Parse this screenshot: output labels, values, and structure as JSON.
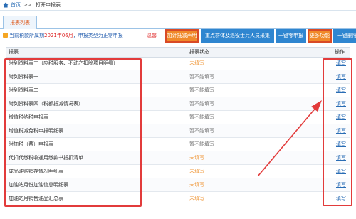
{
  "breadcrumb": {
    "home_label": "首页",
    "separator": ">>",
    "current": "打开申报表"
  },
  "tab": {
    "label": "报表列表"
  },
  "notice": {
    "prefix": "当前税款所属期",
    "period": "2021年06月",
    "middle": "，申报类型为",
    "type": "正常申报",
    "tip": "温馨"
  },
  "toolbar": {
    "buttons": [
      {
        "label": "加计抵减声明",
        "style": "orange"
      },
      {
        "label": "重点群体及退役士兵人员采集",
        "style": "blue"
      },
      {
        "label": "一键零申报",
        "style": "blue"
      },
      {
        "label": "更多功能",
        "style": "orange"
      },
      {
        "label": "一键删除",
        "style": "blue"
      }
    ]
  },
  "table": {
    "headers": [
      "报表",
      "报表状态",
      "操作"
    ],
    "rows": [
      {
        "name": "附列资料表三（应税服务、不动产扣除项目明细）",
        "status": "未填写",
        "status_kind": "todo",
        "action": "填写"
      },
      {
        "name": "附列资料表一",
        "status": "暂不能填写",
        "status_kind": "na",
        "action": "填写"
      },
      {
        "name": "附列资料表二",
        "status": "暂不能填写",
        "status_kind": "na",
        "action": "填写"
      },
      {
        "name": "附列资料表四（税额抵减情况表）",
        "status": "暂不能填写",
        "status_kind": "na",
        "action": "填写"
      },
      {
        "name": "增值税纳税申报表",
        "status": "暂不能填写",
        "status_kind": "na",
        "action": "填写"
      },
      {
        "name": "增值税减免税申报明细表",
        "status": "暂不能填写",
        "status_kind": "na",
        "action": "填写"
      },
      {
        "name": "附加税（费）申报表",
        "status": "暂不能填写",
        "status_kind": "na",
        "action": "填写"
      },
      {
        "name": "代扣代缴税收通用缴款书抵扣清单",
        "status": "未填写",
        "status_kind": "todo",
        "action": "填写"
      },
      {
        "name": "成品油购销存情况明细表",
        "status": "未填写",
        "status_kind": "todo",
        "action": "填写"
      },
      {
        "name": "加油站月份加油信息明细表",
        "status": "未填写",
        "status_kind": "todo",
        "action": "填写"
      },
      {
        "name": "加油站月销售油品汇总表",
        "status": "未填写",
        "status_kind": "todo",
        "action": "填写"
      }
    ]
  },
  "colors": {
    "accent_blue": "#2f86d0",
    "accent_orange": "#f08a2a",
    "annotation_red": "#e23b3b",
    "status_todo": "#f09a3e"
  }
}
